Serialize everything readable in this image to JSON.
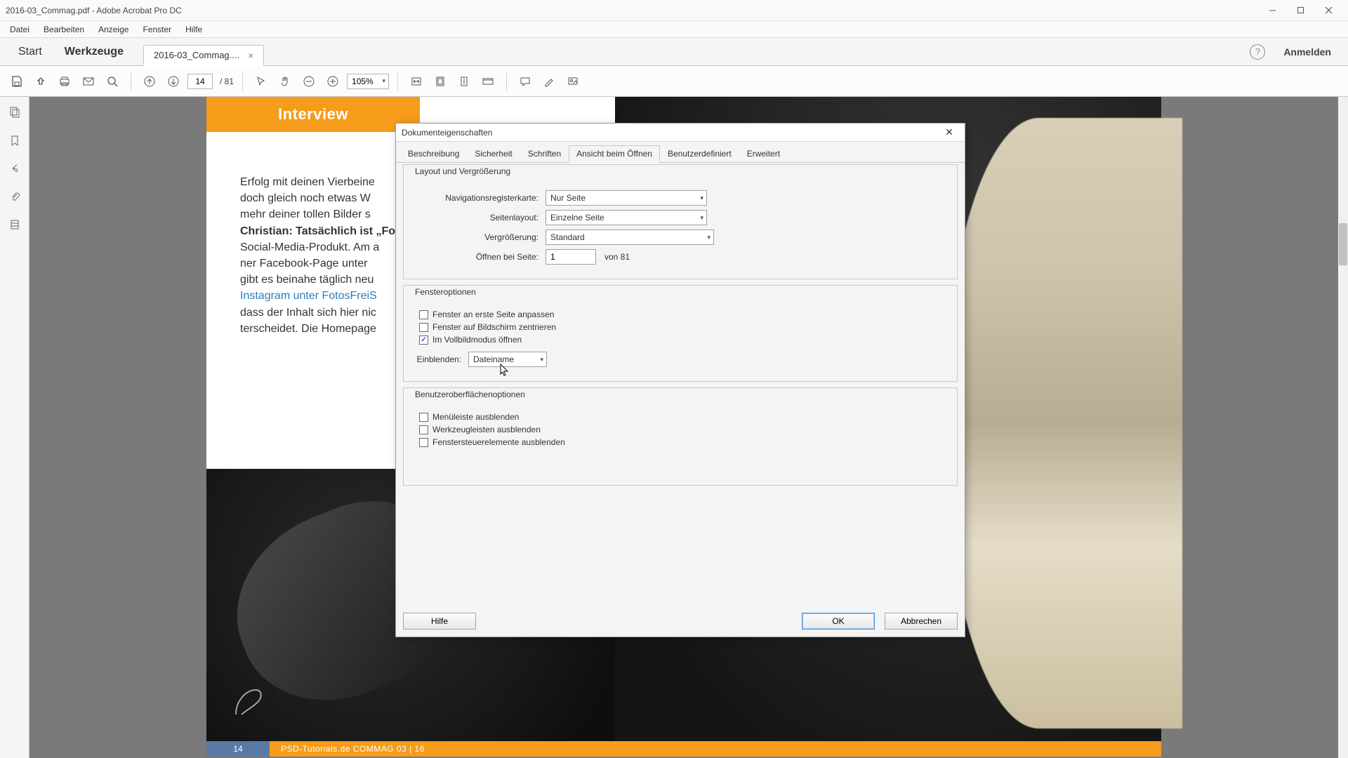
{
  "window": {
    "title": "2016-03_Commag.pdf - Adobe Acrobat Pro DC"
  },
  "menubar": {
    "items": [
      "Datei",
      "Bearbeiten",
      "Anzeige",
      "Fenster",
      "Hilfe"
    ]
  },
  "tabstrip": {
    "start": "Start",
    "tools": "Werkzeuge",
    "file_tab": "2016-03_Commag....",
    "signin": "Anmelden"
  },
  "toolbar": {
    "page_current": "14",
    "page_total": "/ 81",
    "zoom": "105%"
  },
  "document": {
    "interview_label": "Interview",
    "text_lines": [
      "Erfolg mit deinen Vierbeine",
      "doch gleich noch etwas W",
      "mehr deiner tollen Bilder s",
      "Christian: Tatsächlich ist „Fo",
      "Social-Media-Produkt. Am a",
      "ner  Facebook-Page  unter",
      "gibt es beinahe täglich neu",
      "Instagram  unter  FotosFreiS",
      "dass der Inhalt sich hier nic",
      "terscheidet. Die Homepage"
    ],
    "page_number": "14",
    "page_info": "PSD-Tutorials.de   COMMAG 03 | 16"
  },
  "dialog": {
    "title": "Dokumenteigenschaften",
    "tabs": [
      "Beschreibung",
      "Sicherheit",
      "Schriften",
      "Ansicht beim Öffnen",
      "Benutzerdefiniert",
      "Erweitert"
    ],
    "active_tab_index": 3,
    "group1_title": "Layout und Vergrößerung",
    "nav_label": "Navigationsregisterkarte:",
    "nav_value": "Nur Seite",
    "layout_label": "Seitenlayout:",
    "layout_value": "Einzelne Seite",
    "mag_label": "Vergrößerung:",
    "mag_value": "Standard",
    "open_label": "Öffnen bei Seite:",
    "open_value": "1",
    "open_of": "von 81",
    "group2_title": "Fensteroptionen",
    "chk_fit": "Fenster an erste Seite anpassen",
    "chk_center": "Fenster auf Bildschirm zentrieren",
    "chk_full": "Im Vollbildmodus öffnen",
    "show_label": "Einblenden:",
    "show_value": "Dateiname",
    "group3_title": "Benutzeroberflächenoptionen",
    "chk_menu": "Menüleiste ausblenden",
    "chk_tool": "Werkzeugleisten ausblenden",
    "chk_ctrl": "Fenstersteuerelemente ausblenden",
    "btn_help": "Hilfe",
    "btn_ok": "OK",
    "btn_cancel": "Abbrechen"
  }
}
